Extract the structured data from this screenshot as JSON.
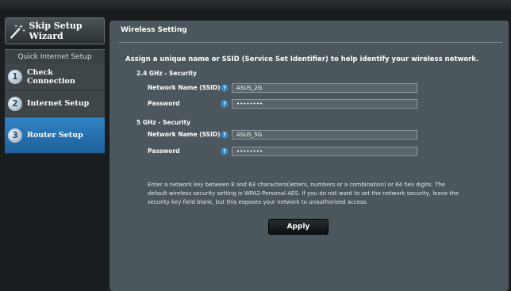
{
  "sidebar": {
    "skip_label": "Skip Setup Wizard",
    "section_title": "Quick Internet Setup",
    "steps": [
      {
        "num": "1",
        "label": "Check Connection"
      },
      {
        "num": "2",
        "label": "Internet Setup"
      },
      {
        "num": "3",
        "label": "Router Setup"
      }
    ]
  },
  "main": {
    "title": "Wireless Setting",
    "intro": "Assign a unique name or SSID (Service Set Identifier) to help identify your wireless network.",
    "band_24": {
      "heading": "2.4 GHz - Security",
      "ssid_label": "Network Name (SSID)",
      "ssid_value": "ASUS_2G",
      "password_label": "Password",
      "password_value": "••••••••"
    },
    "band_5": {
      "heading": "5 GHz - Security",
      "ssid_label": "Network Name (SSID)",
      "ssid_value": "ASUS_5G",
      "password_label": "Password",
      "password_value": "••••••••"
    },
    "help_mark": "?",
    "note": "Enter a network key between 8 and 63 characters(letters, numbers or a combination) or 64 hex digits. The default wireless security setting is WPA2-Personal AES. If you do not want to set the network security, leave the security key field blank, but this exposes your network to unauthorized access.",
    "apply_label": "Apply"
  },
  "colors": {
    "accent": "#2a7bc0",
    "panel": "#4b575c",
    "background": "#1a1d20"
  }
}
